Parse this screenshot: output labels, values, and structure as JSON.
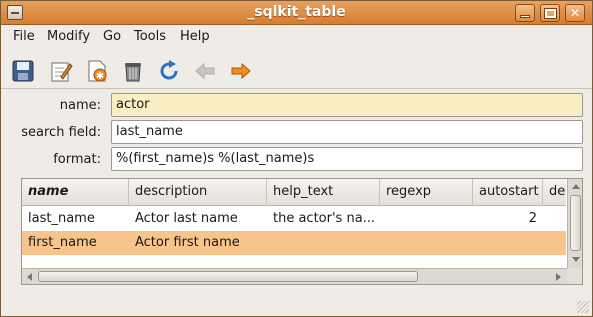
{
  "window": {
    "title": "_sqlkit_table"
  },
  "menu": [
    "File",
    "Modify",
    "Go",
    "Tools",
    "Help"
  ],
  "toolbar": {
    "icons": [
      "save-icon",
      "edit-icon",
      "new-record-icon",
      "trash-icon",
      "refresh-icon",
      "back-arrow-icon",
      "forward-arrow-icon"
    ]
  },
  "form": {
    "name_label": "name:",
    "name_value": "actor",
    "search_label": "search field:",
    "search_value": "last_name",
    "format_label": "format:",
    "format_value": "%(first_name)s %(last_name)s"
  },
  "table": {
    "columns": [
      "name",
      "description",
      "help_text",
      "regexp",
      "autostart",
      "de"
    ],
    "rows": [
      {
        "name": "last_name",
        "description": "Actor last name",
        "help_text": "the actor's na...",
        "regexp": "",
        "autostart": "2"
      },
      {
        "name": "first_name",
        "description": "Actor first name",
        "help_text": "",
        "regexp": "",
        "autostart": ""
      }
    ]
  },
  "colors": {
    "titlebar": "#d98a42",
    "selected_row": "#f7c58c",
    "highlight_field": "#f9eec2"
  }
}
